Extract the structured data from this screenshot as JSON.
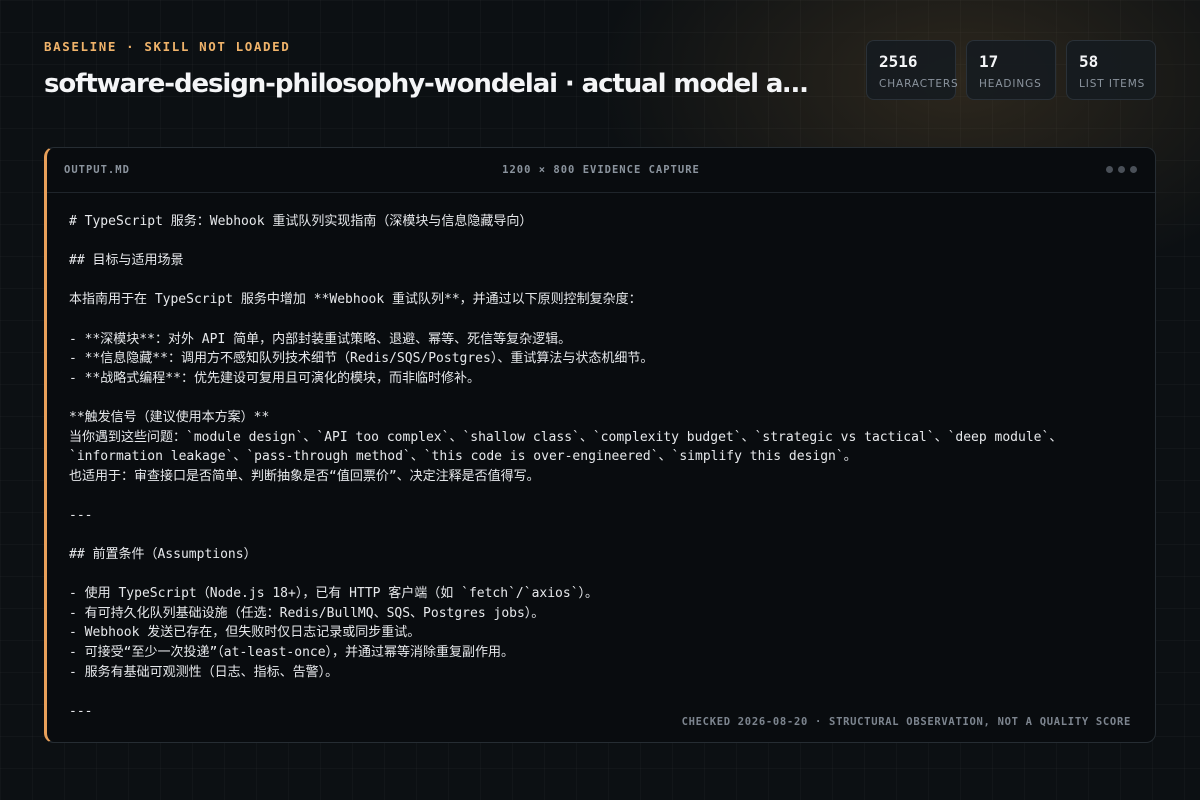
{
  "header": {
    "eyebrow": "BASELINE · SKILL NOT LOADED",
    "title": "software-design-philosophy-wondelai · actual model ar…"
  },
  "stats": [
    {
      "value": "2516",
      "label": "CHARACTERS"
    },
    {
      "value": "17",
      "label": "HEADINGS"
    },
    {
      "value": "58",
      "label": "LIST ITEMS"
    }
  ],
  "panel": {
    "file_name": "OUTPUT.MD",
    "capture_label": "1200 × 800 EVIDENCE CAPTURE",
    "footer": "CHECKED 2026-08-20 · STRUCTURAL OBSERVATION, NOT A QUALITY SCORE",
    "lines": [
      "# TypeScript 服务：Webhook 重试队列实现指南（深模块与信息隐藏导向）",
      "",
      "## 目标与适用场景",
      "",
      "本指南用于在 TypeScript 服务中增加 **Webhook 重试队列**，并通过以下原则控制复杂度：",
      "",
      "- **深模块**：对外 API 简单，内部封装重试策略、退避、幂等、死信等复杂逻辑。",
      "- **信息隐藏**：调用方不感知队列技术细节（Redis/SQS/Postgres）、重试算法与状态机细节。",
      "- **战略式编程**：优先建设可复用且可演化的模块，而非临时修补。",
      "",
      "**触发信号（建议使用本方案）**",
      "当你遇到这些问题：`module design`、`API too complex`、`shallow class`、`complexity budget`、`strategic vs tactical`、`deep module`、",
      "`information leakage`、`pass-through method`、`this code is over-engineered`、`simplify this design`。",
      "也适用于：审查接口是否简单、判断抽象是否“值回票价”、决定注释是否值得写。",
      "",
      "---",
      "",
      "## 前置条件（Assumptions）",
      "",
      "- 使用 TypeScript（Node.js 18+），已有 HTTP 客户端（如 `fetch`/`axios`）。",
      "- 有可持久化队列基础设施（任选：Redis/BullMQ、SQS、Postgres jobs）。",
      "- Webhook 发送已存在，但失败时仅日志记录或同步重试。",
      "- 可接受“至少一次投递”（at-least-once），并通过幂等消除重复副作用。",
      "- 服务有基础可观测性（日志、指标、告警）。",
      "",
      "---"
    ]
  },
  "colors": {
    "accent": "#e8a05a",
    "eyebrow": "#f0b36a",
    "background": "#0c1013",
    "panel": "#090c0f"
  }
}
